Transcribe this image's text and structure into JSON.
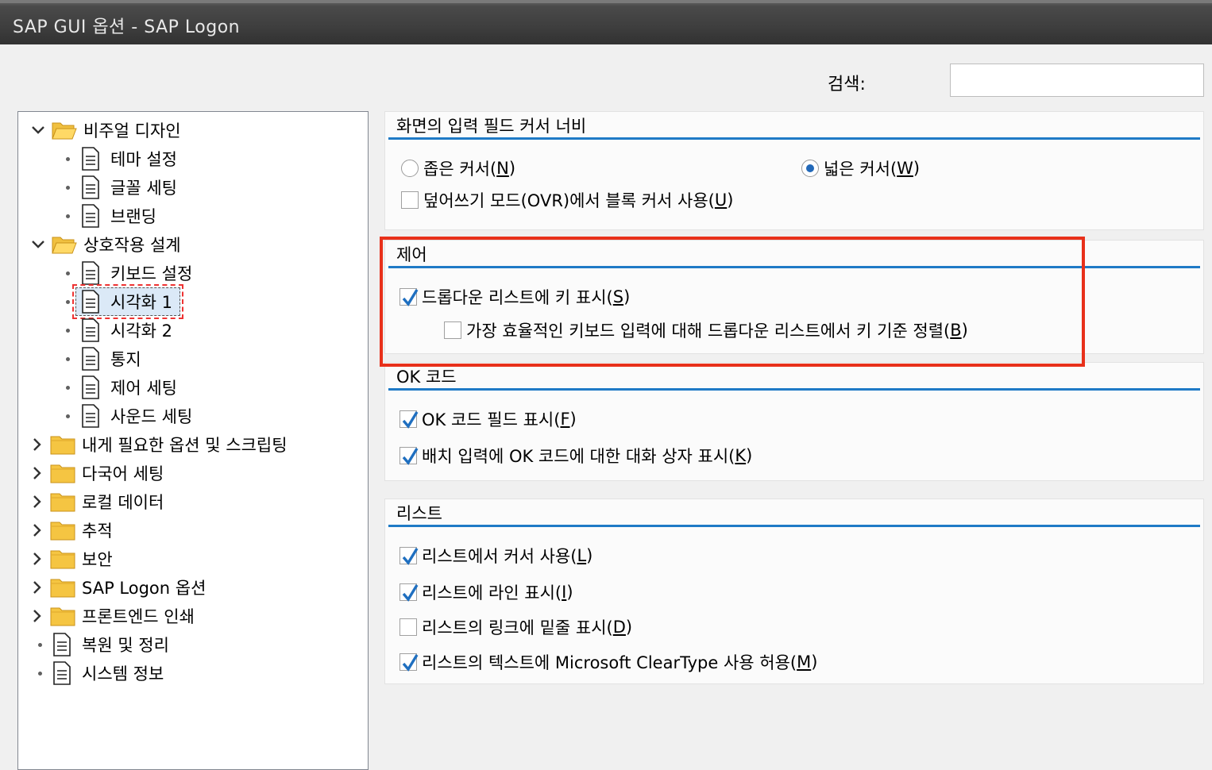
{
  "window": {
    "title": "SAP GUI 옵션 - SAP Logon"
  },
  "search": {
    "label": "검색:",
    "value": ""
  },
  "tree": {
    "visual_design": {
      "label": "비주얼 디자인",
      "children": [
        "테마 설정",
        "글꼴 세팅",
        "브랜딩"
      ]
    },
    "interaction_design": {
      "label": "상호작용 설계",
      "children": [
        "키보드 설정",
        "시각화 1",
        "시각화 2",
        "통지",
        "제어 세팅",
        "사운드 세팅"
      ],
      "selected": "시각화 1"
    },
    "collapsed_folders": [
      "내게 필요한 옵션 및 스크립팅",
      "다국어 세팅",
      "로컬 데이터",
      "추적",
      "보안",
      "SAP Logon 옵션",
      "프론트엔드 인쇄"
    ],
    "leaf_items": [
      "복원 및 정리",
      "시스템 정보"
    ]
  },
  "groups": {
    "cursor": {
      "title": "화면의 입력 필드 커서 너비",
      "narrow": {
        "label": "좁은 커서(",
        "key": "N",
        "end": ")",
        "checked": false
      },
      "wide": {
        "label": "넓은 커서(",
        "key": "W",
        "end": ")",
        "checked": true
      },
      "ovr": {
        "label": "덮어쓰기 모드(OVR)에서 블록 커서 사용(",
        "key": "U",
        "end": ")",
        "checked": false
      }
    },
    "control": {
      "title": "제어",
      "dropdown_keys": {
        "label": "드롭다운 리스트에 키 표시(",
        "key": "S",
        "end": ")",
        "checked": true
      },
      "sort_keys": {
        "label": "가장 효율적인 키보드 입력에 대해 드롭다운 리스트에서 키 기준 정렬(",
        "key": "B",
        "end": ")",
        "checked": false
      }
    },
    "okcode": {
      "title": "OK 코드",
      "show_field": {
        "label": "OK 코드 필드 표시(",
        "key": "F",
        "end": ")",
        "checked": true
      },
      "batch_dialog": {
        "label": "배치 입력에 OK 코드에 대한 대화 상자 표시(",
        "key": "K",
        "end": ")",
        "checked": true
      }
    },
    "list": {
      "title": "리스트",
      "cursor": {
        "label": "리스트에서 커서 사용(",
        "key": "L",
        "end": ")",
        "checked": true
      },
      "lines": {
        "label": "리스트에 라인 표시(",
        "key": "I",
        "end": ")",
        "checked": true
      },
      "underline": {
        "label": "리스트의 링크에 밑줄 표시(",
        "key": "D",
        "end": ")",
        "checked": false
      },
      "cleartype": {
        "label": "리스트의 텍스트에 Microsoft ClearType 사용 허용(",
        "key": "M",
        "end": ")",
        "checked": true
      }
    }
  },
  "colors": {
    "accent_line": "#1f7ac6",
    "highlight": "#e8301a",
    "check": "#1f6fc0"
  }
}
